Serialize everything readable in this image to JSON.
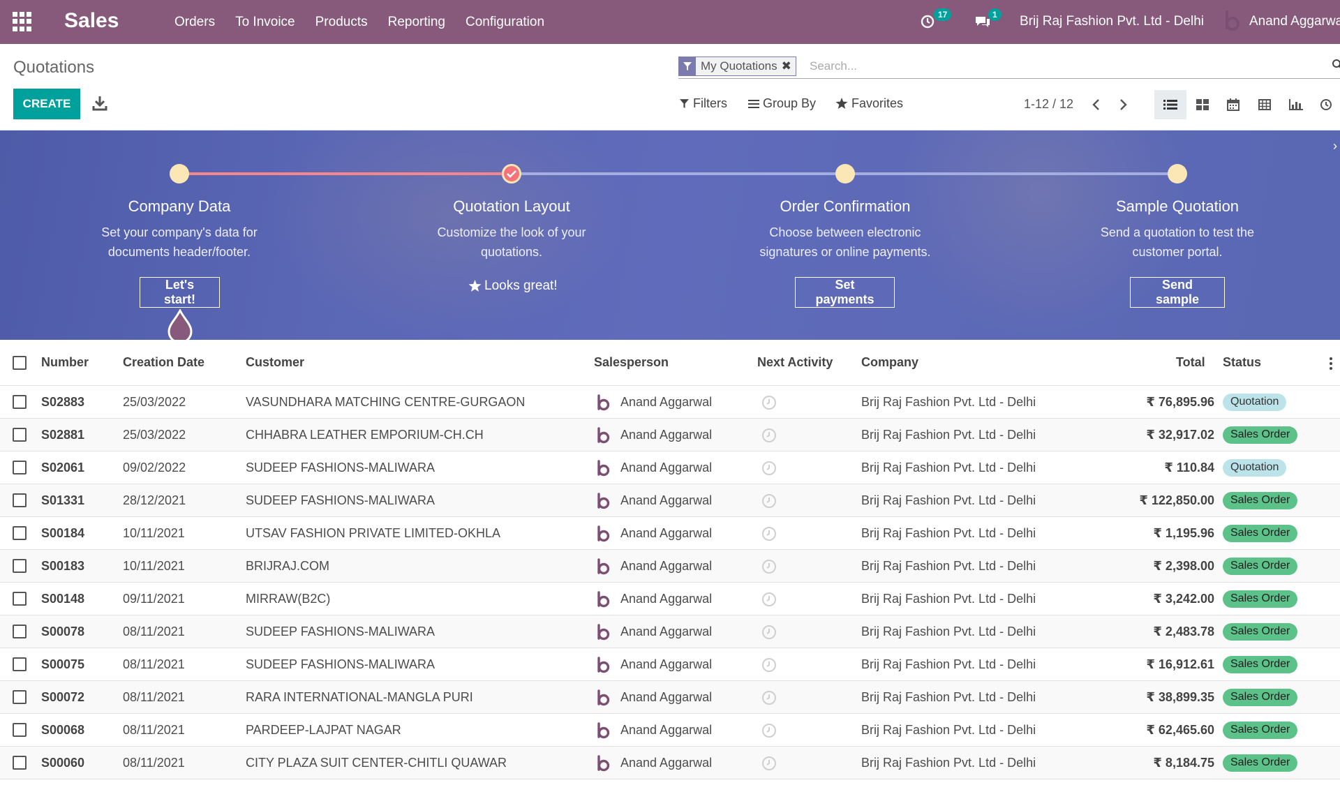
{
  "navbar": {
    "app_name": "Sales",
    "menu": [
      "Orders",
      "To Invoice",
      "Products",
      "Reporting",
      "Configuration"
    ],
    "activity_count": "17",
    "message_count": "1",
    "company": "Brij Raj Fashion Pvt. Ltd - Delhi",
    "user": "Anand Aggarwal"
  },
  "control_panel": {
    "breadcrumb": "Quotations",
    "create_label": "CREATE",
    "facet_label": "My Quotations",
    "search_placeholder": "Search...",
    "filters_label": "Filters",
    "groupby_label": "Group By",
    "favorites_label": "Favorites",
    "pager": "1-12 / 12"
  },
  "onboarding": {
    "steps": [
      {
        "title": "Company Data",
        "desc_line1": "Set your company's data for",
        "desc_line2": "documents header/footer.",
        "button": "Let's start!"
      },
      {
        "title": "Quotation Layout",
        "desc_line1": "Customize the look of your",
        "desc_line2": "quotations.",
        "done_label": "Looks great!"
      },
      {
        "title": "Order Confirmation",
        "desc_line1": "Choose between electronic",
        "desc_line2": "signatures or online payments.",
        "button": "Set payments"
      },
      {
        "title": "Sample Quotation",
        "desc_line1": "Send a quotation to test the",
        "desc_line2": "customer portal.",
        "button": "Send sample"
      }
    ]
  },
  "table": {
    "columns": {
      "number": "Number",
      "date": "Creation Date",
      "customer": "Customer",
      "salesperson": "Salesperson",
      "activity": "Next Activity",
      "company": "Company",
      "total": "Total",
      "status": "Status"
    },
    "rows": [
      {
        "number": "S02883",
        "date": "25/03/2022",
        "customer": "VASUNDHARA MATCHING CENTRE-GURGAON",
        "salesperson": "Anand Aggarwal",
        "company": "Brij Raj Fashion Pvt. Ltd - Delhi",
        "total": "₹ 76,895.96",
        "status": "Quotation"
      },
      {
        "number": "S02881",
        "date": "25/03/2022",
        "customer": "CHHABRA LEATHER EMPORIUM-CH.CH",
        "salesperson": "Anand Aggarwal",
        "company": "Brij Raj Fashion Pvt. Ltd - Delhi",
        "total": "₹ 32,917.02",
        "status": "Sales Order"
      },
      {
        "number": "S02061",
        "date": "09/02/2022",
        "customer": "SUDEEP FASHIONS-MALIWARA",
        "salesperson": "Anand Aggarwal",
        "company": "Brij Raj Fashion Pvt. Ltd - Delhi",
        "total": "₹ 110.84",
        "status": "Quotation"
      },
      {
        "number": "S01331",
        "date": "28/12/2021",
        "customer": "SUDEEP FASHIONS-MALIWARA",
        "salesperson": "Anand Aggarwal",
        "company": "Brij Raj Fashion Pvt. Ltd - Delhi",
        "total": "₹ 122,850.00",
        "status": "Sales Order"
      },
      {
        "number": "S00184",
        "date": "10/11/2021",
        "customer": "UTSAV FASHION PRIVATE LIMITED-OKHLA",
        "salesperson": "Anand Aggarwal",
        "company": "Brij Raj Fashion Pvt. Ltd - Delhi",
        "total": "₹ 1,195.96",
        "status": "Sales Order"
      },
      {
        "number": "S00183",
        "date": "10/11/2021",
        "customer": "BRIJRAJ.COM",
        "salesperson": "Anand Aggarwal",
        "company": "Brij Raj Fashion Pvt. Ltd - Delhi",
        "total": "₹ 2,398.00",
        "status": "Sales Order"
      },
      {
        "number": "S00148",
        "date": "09/11/2021",
        "customer": "MIRRAW(B2C)",
        "salesperson": "Anand Aggarwal",
        "company": "Brij Raj Fashion Pvt. Ltd - Delhi",
        "total": "₹ 3,242.00",
        "status": "Sales Order"
      },
      {
        "number": "S00078",
        "date": "08/11/2021",
        "customer": "SUDEEP FASHIONS-MALIWARA",
        "salesperson": "Anand Aggarwal",
        "company": "Brij Raj Fashion Pvt. Ltd - Delhi",
        "total": "₹ 2,483.78",
        "status": "Sales Order"
      },
      {
        "number": "S00075",
        "date": "08/11/2021",
        "customer": "SUDEEP FASHIONS-MALIWARA",
        "salesperson": "Anand Aggarwal",
        "company": "Brij Raj Fashion Pvt. Ltd - Delhi",
        "total": "₹ 16,912.61",
        "status": "Sales Order"
      },
      {
        "number": "S00072",
        "date": "08/11/2021",
        "customer": "RARA INTERNATIONAL-MANGLA PURI",
        "salesperson": "Anand Aggarwal",
        "company": "Brij Raj Fashion Pvt. Ltd - Delhi",
        "total": "₹ 38,899.35",
        "status": "Sales Order"
      },
      {
        "number": "S00068",
        "date": "08/11/2021",
        "customer": "PARDEEP-LAJPAT NAGAR",
        "salesperson": "Anand Aggarwal",
        "company": "Brij Raj Fashion Pvt. Ltd - Delhi",
        "total": "₹ 62,465.60",
        "status": "Sales Order"
      },
      {
        "number": "S00060",
        "date": "08/11/2021",
        "customer": "CITY PLAZA SUIT CENTER-CHITLI QUAWAR",
        "salesperson": "Anand Aggarwal",
        "company": "Brij Raj Fashion Pvt. Ltd - Delhi",
        "total": "₹ 8,184.75",
        "status": "Sales Order"
      }
    ]
  },
  "colors": {
    "navbar": "#875a7b",
    "primary": "#00a09d",
    "quotation_badge": "#bde3ea",
    "sales_order_badge": "#5cc28a"
  },
  "icons": [
    "apps-grid-icon",
    "activity-clock-icon",
    "chat-icon",
    "download-icon",
    "filter-icon",
    "close-icon",
    "search-icon",
    "list-view-icon",
    "kanban-view-icon",
    "calendar-view-icon",
    "pivot-view-icon",
    "graph-view-icon",
    "activity-view-icon",
    "star-icon",
    "chevron-left-icon",
    "chevron-right-icon",
    "kebab-icon"
  ]
}
